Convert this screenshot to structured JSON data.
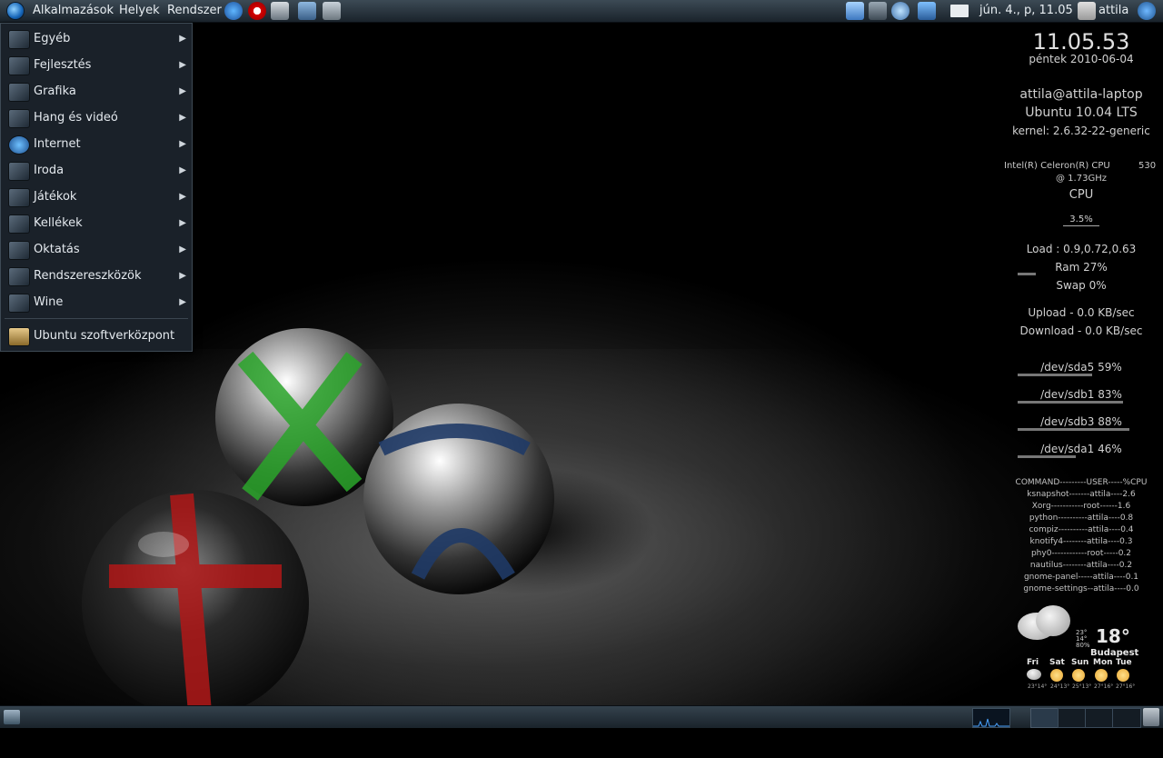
{
  "top_panel": {
    "menus": [
      "Alkalmazások",
      "Helyek",
      "Rendszer"
    ],
    "clock": "jún. 4., p, 11.05",
    "user": "attila",
    "icons": [
      "ubuntu-logo-icon",
      "ie-icon",
      "opera-icon",
      "system-monitor-icon",
      "network-icon",
      "virtualbox-icon"
    ],
    "tray_icons": [
      "weather-icon",
      "network-status-icon",
      "people-icon",
      "download-icon",
      "mail-icon",
      "avatar-icon",
      "power-icon"
    ]
  },
  "app_menu": {
    "items": [
      {
        "label": "Egyéb",
        "icon": "misc-icon",
        "submenu": true
      },
      {
        "label": "Fejlesztés",
        "icon": "development-icon",
        "submenu": true
      },
      {
        "label": "Grafika",
        "icon": "graphics-icon",
        "submenu": true
      },
      {
        "label": "Hang és videó",
        "icon": "sound-video-icon",
        "submenu": true
      },
      {
        "label": "Internet",
        "icon": "internet-globe-icon",
        "submenu": true
      },
      {
        "label": "Iroda",
        "icon": "office-icon",
        "submenu": true
      },
      {
        "label": "Játékok",
        "icon": "games-icon",
        "submenu": true
      },
      {
        "label": "Kellékek",
        "icon": "accessories-icon",
        "submenu": true
      },
      {
        "label": "Oktatás",
        "icon": "education-icon",
        "submenu": true
      },
      {
        "label": "Rendszereszközök",
        "icon": "system-tools-icon",
        "submenu": true
      },
      {
        "label": "Wine",
        "icon": "wine-icon",
        "submenu": true
      }
    ],
    "software_center": "Ubuntu szoftverközpont"
  },
  "conky": {
    "time": "11.05.53",
    "date": "péntek 2010-06-04",
    "host": "attila@attila-laptop",
    "os": "Ubuntu 10.04 LTS",
    "kernel": "kernel: 2.6.32-22-generic",
    "cpu_model_line1": "Intel(R) Celeron(R) CPU",
    "cpu_model_num": "530",
    "cpu_model_line2": "@ 1.73GHz",
    "cpu_label": "CPU",
    "cpu_usage": "3.5%",
    "load": "Load : 0.9,0.72,0.63",
    "ram": "Ram 27%",
    "swap": "Swap 0%",
    "upload": "Upload - 0.0 KB/sec",
    "download": "Download - 0.0 KB/sec",
    "disks": [
      {
        "label": "/dev/sda5 59%",
        "percent": 59
      },
      {
        "label": "/dev/sdb1 83%",
        "percent": 83
      },
      {
        "label": "/dev/sdb3 88%",
        "percent": 88
      },
      {
        "label": "/dev/sda1 46%",
        "percent": 46
      }
    ],
    "ram_percent": 27,
    "processes": [
      "COMMAND---------USER-----%CPU",
      "ksnapshot-------attila----2.6",
      "Xorg-----------root------1.6",
      "python----------attila----0.8",
      "compiz----------attila----0.4",
      "knotify4--------attila----0.3",
      "phy0------------root-----0.2",
      "nautilus--------attila----0.2",
      "gnome-panel-----attila----0.1",
      "gnome-settings--attila----0.0"
    ]
  },
  "weather": {
    "temp": "18°",
    "high": "23°",
    "low": "14°",
    "humidity": "80%",
    "city": "Budapest",
    "days": [
      "Fri",
      "Sat",
      "Sun",
      "Mon",
      "Tue"
    ],
    "day_temps": [
      "23°14°",
      "24°13°",
      "25°13°",
      "27°16°",
      "27°16°"
    ]
  },
  "colors": {
    "panel": "#1a232b",
    "menu_bg": "#1a2129",
    "accent_green": "#2aa52a",
    "accent_red": "#b01818",
    "accent_blue": "#2a4a7a"
  }
}
